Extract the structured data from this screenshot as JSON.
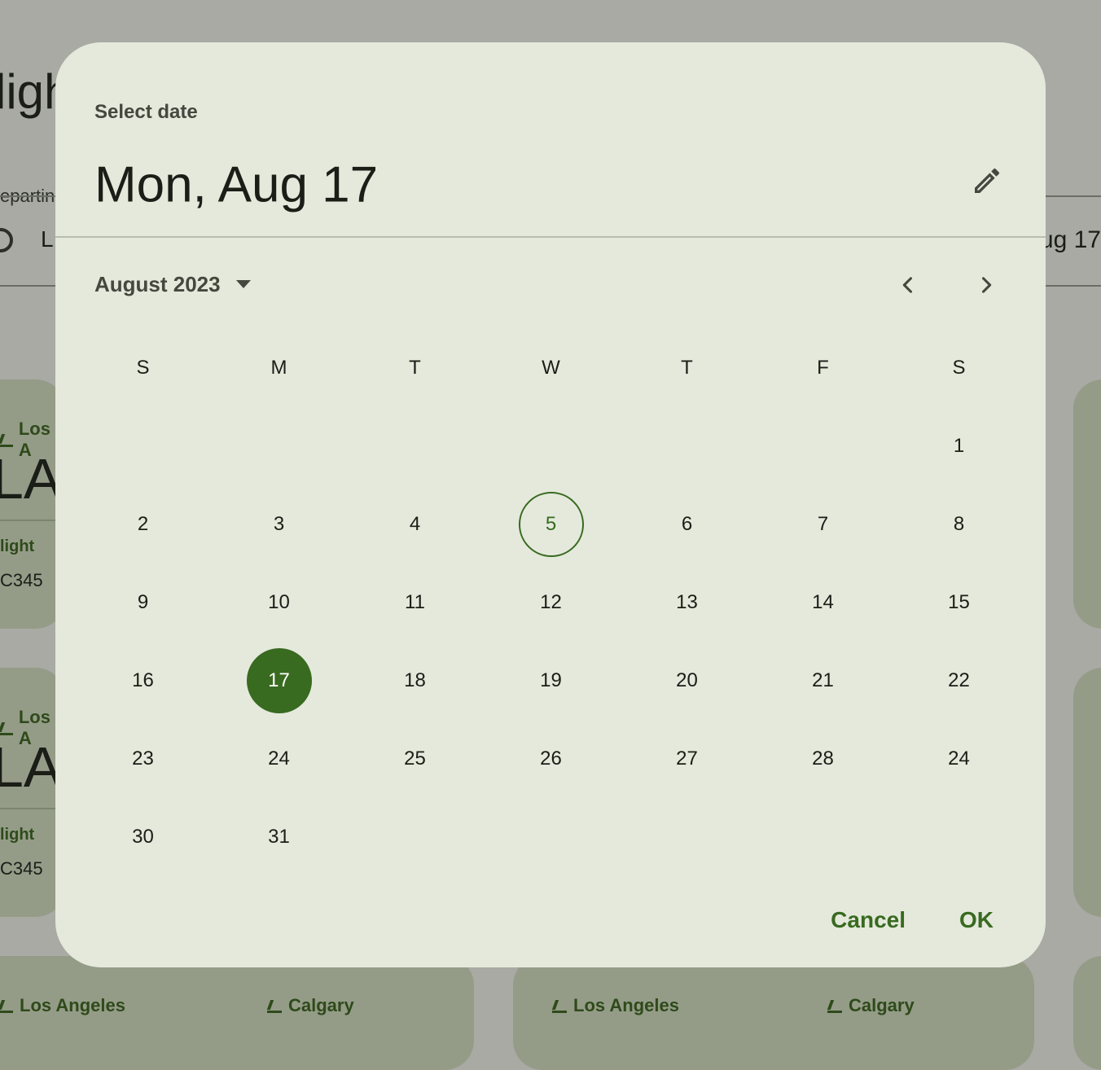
{
  "background": {
    "title": "ligh",
    "field_label": "epartin",
    "field_value": "L",
    "field_date": "ug 17",
    "cards": [
      {
        "city": "Los A",
        "code": "LA",
        "flight_label": "light",
        "flight_number": "C345"
      },
      {
        "city": "Los A",
        "code": "LA",
        "flight_label": "light",
        "flight_number": "C345"
      }
    ],
    "bottom_cards": [
      {
        "from": "Los Angeles",
        "to": "Calgary"
      },
      {
        "from": "Los Angeles",
        "to": "Calgary"
      }
    ]
  },
  "dialog": {
    "label": "Select date",
    "headline": "Mon, Aug 17",
    "edit_icon": "pencil-icon",
    "month_label": "August 2023",
    "dropdown_icon": "caret-down-icon",
    "prev_icon": "chevron-left-icon",
    "next_icon": "chevron-right-icon",
    "weekdays": [
      "S",
      "M",
      "T",
      "W",
      "T",
      "F",
      "S"
    ],
    "weeks": [
      [
        "",
        "",
        "",
        "",
        "",
        "",
        "1"
      ],
      [
        "2",
        "3",
        "4",
        "5",
        "6",
        "7",
        "8"
      ],
      [
        "9",
        "10",
        "11",
        "12",
        "13",
        "14",
        "15"
      ],
      [
        "16",
        "17",
        "18",
        "19",
        "20",
        "21",
        "22"
      ],
      [
        "23",
        "24",
        "25",
        "26",
        "27",
        "28",
        "24"
      ],
      [
        "30",
        "31",
        "",
        "",
        "",
        "",
        ""
      ]
    ],
    "today": "5",
    "selected": "17",
    "cancel_label": "Cancel",
    "ok_label": "OK"
  },
  "colors": {
    "primary": "#386a20",
    "surface": "#e5e9dc",
    "scrim": "#a9aaa4"
  }
}
